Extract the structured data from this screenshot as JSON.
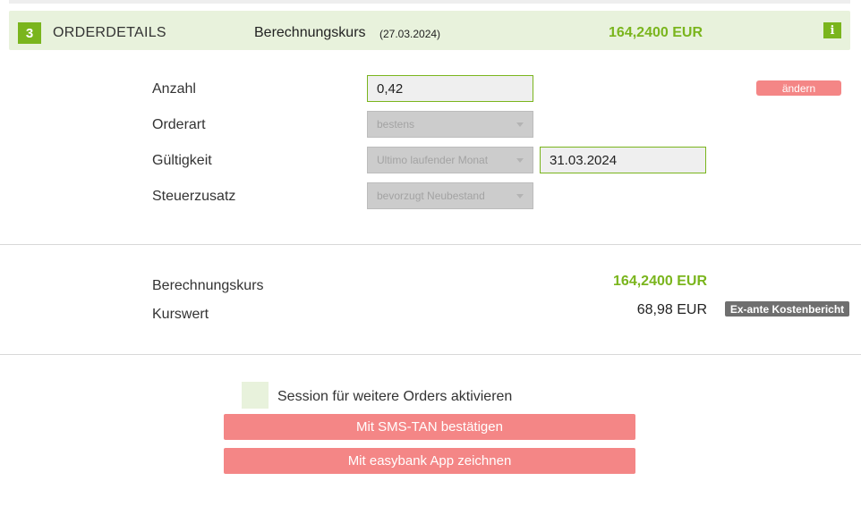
{
  "header": {
    "step_number": "3",
    "title": "ORDERDETAILS",
    "kurs_label": "Berechnungskurs",
    "kurs_date": "(27.03.2024)",
    "kurs_value": "164,2400 EUR",
    "info_icon": "i"
  },
  "form": {
    "anzahl_label": "Anzahl",
    "anzahl_value": "0,42",
    "aendern_label": "ändern",
    "orderart_label": "Orderart",
    "orderart_value": "bestens",
    "gueltigkeit_label": "Gültigkeit",
    "gueltigkeit_value": "Ultimo laufender Monat",
    "gueltigkeit_date": "31.03.2024",
    "steuerzusatz_label": "Steuerzusatz",
    "steuerzusatz_value": "bevorzugt Neubestand"
  },
  "calculation": {
    "berechnungskurs_label": "Berechnungskurs",
    "berechnungskurs_value": "164,2400 EUR",
    "kurswert_label": "Kurswert",
    "kurswert_value": "68,98 EUR",
    "kostenbericht_label": "Ex-ante Kostenbericht"
  },
  "actions": {
    "session_label": "Session für weitere Orders aktivieren",
    "sms_tan_label": "Mit SMS-TAN bestätigen",
    "app_label": "Mit easybank App zeichnen"
  },
  "colors": {
    "accent_green": "#7ab51d",
    "header_bg": "#e8f2dc",
    "action_red": "#f48686",
    "disabled_grey": "#cccccc"
  }
}
